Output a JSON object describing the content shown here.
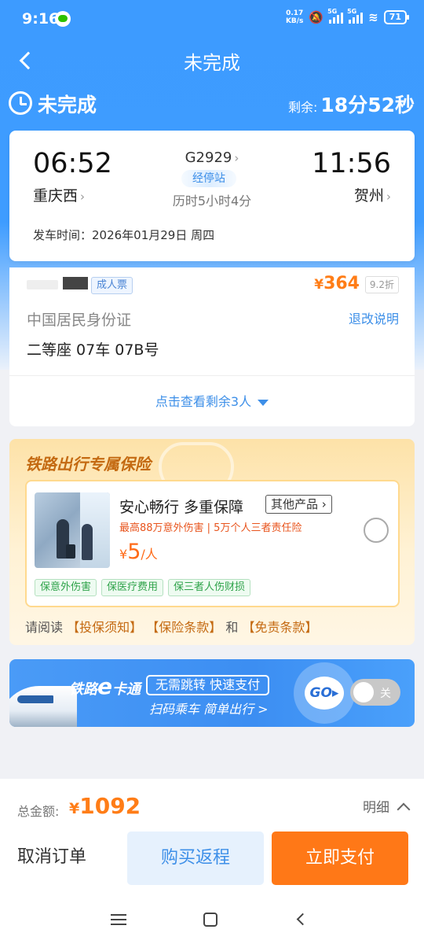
{
  "status_bar": {
    "time": "9:16",
    "speed_value": "0.17",
    "speed_unit": "KB/s",
    "network1": "5G",
    "network2": "5G",
    "battery": "71"
  },
  "header": {
    "title": "未完成"
  },
  "order_status": {
    "title": "未完成",
    "remaining_label": "剩余:",
    "remaining_time": "18分52秒"
  },
  "trip": {
    "departure_time": "06:52",
    "departure_station": "重庆西",
    "arrival_time": "11:56",
    "arrival_station": "贺州",
    "train_number": "G2929",
    "stops_label": "经停站",
    "duration": "历时5小时4分",
    "departure_date": "发车时间：2026年01月29日 周四"
  },
  "passenger": {
    "ticket_type": "成人票",
    "price_symbol": "¥",
    "price": "364",
    "discount": "9.2折",
    "id_type": "中国居民身份证",
    "refund_link": "退改说明",
    "seat": "二等座 07车 07B号",
    "more_passengers": "点击查看剩余3人"
  },
  "insurance": {
    "section_title": "铁路出行专属保险",
    "product_name": "安心畅行 多重保障",
    "other_products": "其他产品",
    "coverage": "最高88万意外伤害 | 5万个人三者责任险",
    "price_symbol": "¥",
    "price": "5",
    "price_unit": "/人",
    "tags": [
      "保意外伤害",
      "保医疗费用",
      "保三者人伤财损"
    ],
    "terms_prefix": "请阅读",
    "terms_1": "【投保须知】",
    "terms_2": "【保险条款】",
    "terms_and": "和",
    "terms_3": "【免责条款】"
  },
  "banner": {
    "brand_pre": "铁路",
    "brand_e": "e",
    "brand_post": "卡通",
    "pill": "无需跳转  快速支付",
    "slogan": "扫码乘车  简单出行 >",
    "go": "GO",
    "toggle_label": "关"
  },
  "footer": {
    "total_label": "总金额:",
    "total_symbol": "¥",
    "total_amount": "1092",
    "detail_label": "明细",
    "cancel_label": "取消订单",
    "return_label": "购买返程",
    "pay_label": "立即支付"
  },
  "colors": {
    "primary_blue": "#3d9bff",
    "accent_orange": "#ff7d17",
    "pay_button": "#ff7817"
  }
}
